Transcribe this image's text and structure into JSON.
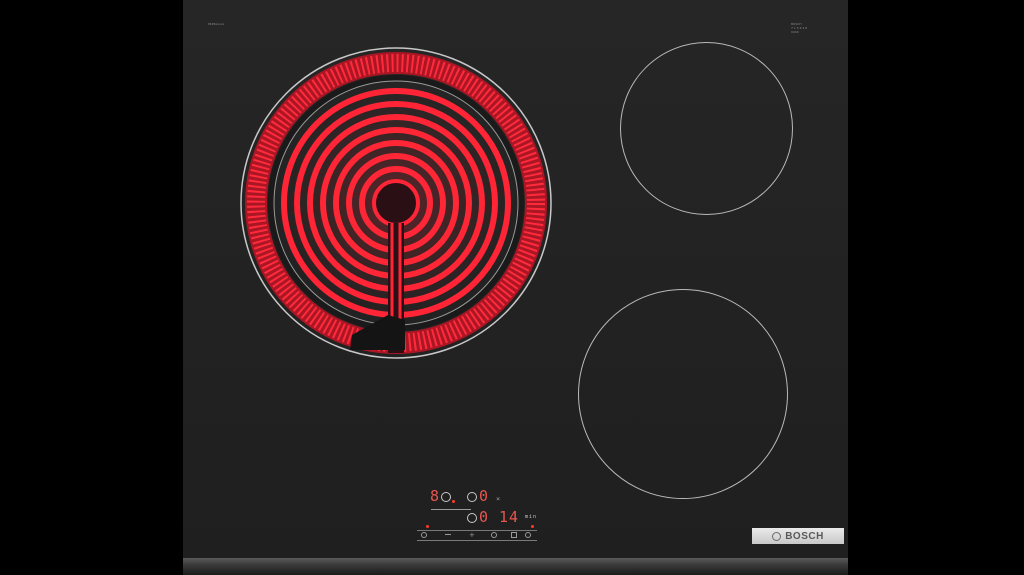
{
  "hob": {
    "model_label": "PKP6xxxxx",
    "corner_label_lines": [
      "BOSCH",
      "7 1 5 6 4 8",
      "0000"
    ],
    "brand": "BOSCH",
    "colors": {
      "glass": "#222222",
      "ring": "#b9b9b9",
      "heat": "#ff1e2d",
      "display": "#e8554e"
    }
  },
  "zones": [
    {
      "id": "front-left",
      "state": "heating",
      "icon": "radiant-spiral-element"
    },
    {
      "id": "back-right",
      "state": "off"
    },
    {
      "id": "front-right",
      "state": "off"
    }
  ],
  "control_panel": {
    "display_left": "8",
    "display_top_right": "0",
    "display_bottom_right": "0",
    "timer": "14",
    "timer_unit": "min",
    "icons": [
      "power-icon",
      "minus-icon",
      "plus-icon",
      "timer-icon",
      "lock-icon"
    ]
  }
}
